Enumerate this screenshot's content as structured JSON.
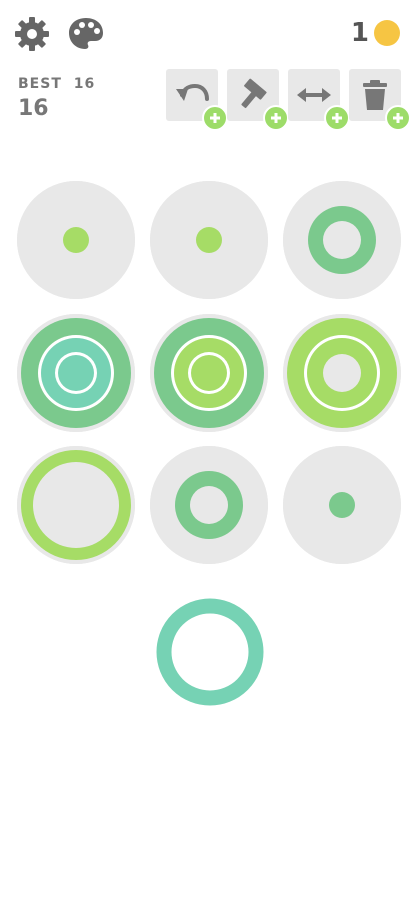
{
  "header": {
    "settings_icon": "gear-icon",
    "theme_icon": "palette-icon",
    "coins": "1",
    "coin_color": "#f6c543"
  },
  "score": {
    "best_label": "BEST",
    "best_value": "16",
    "current": "16"
  },
  "tools": [
    {
      "name": "undo",
      "icon": "undo-icon"
    },
    {
      "name": "hammer",
      "icon": "hammer-icon"
    },
    {
      "name": "swap",
      "icon": "swap-icon"
    },
    {
      "name": "trash",
      "icon": "trash-icon"
    }
  ],
  "colors": {
    "board": "#e8e8e8",
    "teal": "#76d2b4",
    "green": "#7bc98d",
    "lime": "#a6dc66",
    "ring_gap": "#ffffff"
  },
  "board": [
    {
      "row": 0,
      "col": 0,
      "rings": {
        "small": "lime"
      }
    },
    {
      "row": 0,
      "col": 1,
      "rings": {
        "small": "lime"
      }
    },
    {
      "row": 0,
      "col": 2,
      "rings": {
        "medium": "green"
      }
    },
    {
      "row": 1,
      "col": 0,
      "rings": {
        "large": "green",
        "medium": "teal",
        "small": "teal"
      }
    },
    {
      "row": 1,
      "col": 1,
      "rings": {
        "large": "green",
        "medium": "lime",
        "small": "lime"
      }
    },
    {
      "row": 1,
      "col": 2,
      "rings": {
        "large": "lime",
        "medium": "lime"
      }
    },
    {
      "row": 2,
      "col": 0,
      "rings": {
        "large": "lime"
      }
    },
    {
      "row": 2,
      "col": 1,
      "rings": {
        "medium": "green"
      }
    },
    {
      "row": 2,
      "col": 2,
      "rings": {
        "small": "green"
      }
    }
  ],
  "next_piece": {
    "rings": {
      "large": "teal"
    }
  }
}
